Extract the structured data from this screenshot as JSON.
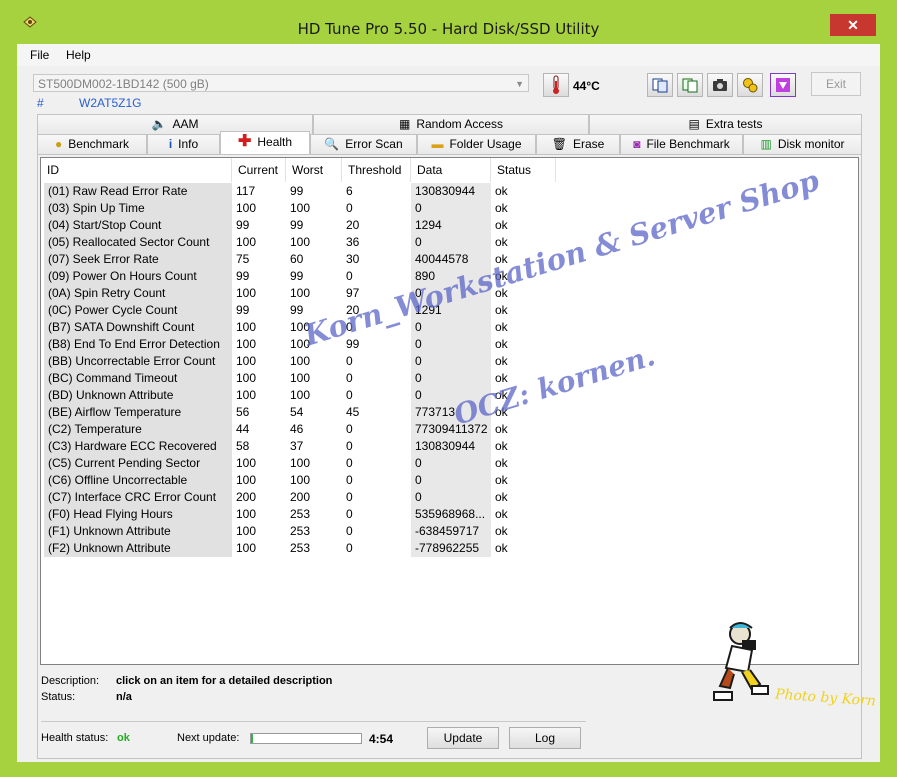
{
  "window": {
    "title": "HD Tune Pro 5.50 - Hard Disk/SSD Utility",
    "close_glyph": "✕"
  },
  "menu": [
    {
      "label": "File"
    },
    {
      "label": "Help"
    }
  ],
  "drive": {
    "name": "ST500DM002-1BD142 (500 gB)",
    "serial_prefix": "#",
    "serial": "W2AT5Z1G"
  },
  "temperature": "44",
  "temperature_unit": "°C",
  "exit_label": "Exit",
  "tabs_top": [
    {
      "label": "AAM"
    },
    {
      "label": "Random Access"
    },
    {
      "label": "Extra tests"
    }
  ],
  "tabs_bottom": [
    {
      "label": "Benchmark"
    },
    {
      "label": "Info"
    },
    {
      "label": "Health"
    },
    {
      "label": "Error Scan"
    },
    {
      "label": "Folder Usage"
    },
    {
      "label": "Erase"
    },
    {
      "label": "File Benchmark"
    },
    {
      "label": "Disk monitor"
    }
  ],
  "active_tab": "Health",
  "columns": [
    "ID",
    "Current",
    "Worst",
    "Threshold",
    "Data",
    "Status"
  ],
  "rows": [
    [
      "(01) Raw Read Error Rate",
      "117",
      "99",
      "6",
      "130830944",
      "ok"
    ],
    [
      "(03) Spin Up Time",
      "100",
      "100",
      "0",
      "0",
      "ok"
    ],
    [
      "(04) Start/Stop Count",
      "99",
      "99",
      "20",
      "1294",
      "ok"
    ],
    [
      "(05) Reallocated Sector Count",
      "100",
      "100",
      "36",
      "0",
      "ok"
    ],
    [
      "(07) Seek Error Rate",
      "75",
      "60",
      "30",
      "40044578",
      "ok"
    ],
    [
      "(09) Power On Hours Count",
      "99",
      "99",
      "0",
      "890",
      "ok"
    ],
    [
      "(0A) Spin Retry Count",
      "100",
      "100",
      "97",
      "0",
      "ok"
    ],
    [
      "(0C) Power Cycle Count",
      "99",
      "99",
      "20",
      "1291",
      "ok"
    ],
    [
      "(B7) SATA Downshift Count",
      "100",
      "100",
      "0",
      "0",
      "ok"
    ],
    [
      "(B8) End To End Error Detection",
      "100",
      "100",
      "99",
      "0",
      "ok"
    ],
    [
      "(BB) Uncorrectable Error Count",
      "100",
      "100",
      "0",
      "0",
      "ok"
    ],
    [
      "(BC) Command Timeout",
      "100",
      "100",
      "0",
      "0",
      "ok"
    ],
    [
      "(BD) Unknown Attribute",
      "100",
      "100",
      "0",
      "0",
      "ok"
    ],
    [
      "(BE) Airflow Temperature",
      "56",
      "54",
      "45",
      "773713",
      "ok"
    ],
    [
      "(C2) Temperature",
      "44",
      "46",
      "0",
      "77309411372",
      "ok"
    ],
    [
      "(C3) Hardware ECC Recovered",
      "58",
      "37",
      "0",
      "130830944",
      "ok"
    ],
    [
      "(C5) Current Pending Sector",
      "100",
      "100",
      "0",
      "0",
      "ok"
    ],
    [
      "(C6) Offline Uncorrectable",
      "100",
      "100",
      "0",
      "0",
      "ok"
    ],
    [
      "(C7) Interface CRC Error Count",
      "200",
      "200",
      "0",
      "0",
      "ok"
    ],
    [
      "(F0) Head Flying Hours",
      "100",
      "253",
      "0",
      "535968968...",
      "ok"
    ],
    [
      "(F1) Unknown Attribute",
      "100",
      "253",
      "0",
      "-638459717",
      "ok"
    ],
    [
      "(F2) Unknown Attribute",
      "100",
      "253",
      "0",
      "-778962255",
      "ok"
    ]
  ],
  "description": {
    "label": "Description:",
    "value": "click on an item for a detailed description"
  },
  "status": {
    "label": "Status:",
    "value": "n/a"
  },
  "health": {
    "label": "Health status:",
    "value": "ok",
    "color": "#22b022"
  },
  "next_update": {
    "label": "Next update:",
    "time": "4:54",
    "progress_fraction": 0.02
  },
  "buttons": {
    "update": "Update",
    "log": "Log"
  },
  "watermark": {
    "line1": "Korn_Workstation & Server Shop",
    "line2": "OCZ: kornen."
  },
  "photo_credit": "Photo by Korn",
  "icons": [
    "aam-icon",
    "random-access-icon",
    "extra-tests-icon",
    "benchmark-icon",
    "info-icon",
    "health-cross-icon",
    "error-scan-icon",
    "folder-icon",
    "erase-icon",
    "file-benchmark-icon",
    "disk-monitor-icon",
    "thermometer-icon",
    "copy-icon",
    "camera-icon",
    "options-icon",
    "save-icon"
  ]
}
